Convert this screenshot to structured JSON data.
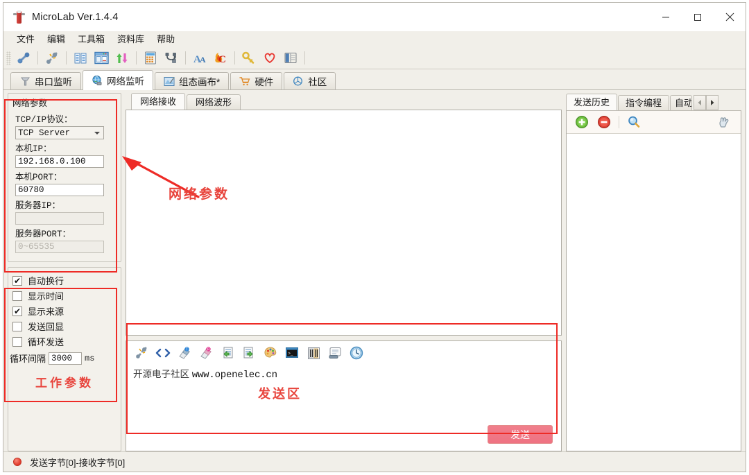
{
  "window": {
    "title": "MicroLab Ver.1.4.4",
    "icon": "app-icon",
    "minimize_label": "─",
    "maximize_label": "□",
    "close_label": "×"
  },
  "menubar": {
    "items": [
      {
        "label": "文件"
      },
      {
        "label": "编辑"
      },
      {
        "label": "工具箱"
      },
      {
        "label": "资料库"
      },
      {
        "label": "帮助"
      }
    ]
  },
  "toolbar": {
    "buttons": [
      {
        "name": "connect-plug-icon"
      },
      {
        "name": "disconnect-plug-icon"
      },
      {
        "name": "columns-view-icon"
      },
      {
        "name": "window-layout-icon"
      },
      {
        "name": "transfer-arrows-icon"
      },
      {
        "name": "calculator-icon"
      },
      {
        "name": "network-nodes-icon"
      },
      {
        "name": "font-icon"
      },
      {
        "name": "c-flame-icon"
      },
      {
        "name": "key-icon"
      },
      {
        "name": "heart-icon"
      },
      {
        "name": "book-icon"
      }
    ]
  },
  "main_tabs": {
    "active_index": 1,
    "items": [
      {
        "label": "串口监听",
        "icon": "serial-port-icon"
      },
      {
        "label": "网络监听",
        "icon": "globe-icon"
      },
      {
        "label": "组态画布*",
        "icon": "canvas-icon"
      },
      {
        "label": "硬件",
        "icon": "cart-icon"
      },
      {
        "label": "社区",
        "icon": "community-icon"
      }
    ]
  },
  "network_params": {
    "group_title": "网络参数",
    "protocol_label": "TCP/IP协议：",
    "protocol_value": "TCP Server",
    "local_ip_label": "本机IP：",
    "local_ip_value": "192.168.0.100",
    "local_port_label": "本机PORT：",
    "local_port_value": "60780",
    "server_ip_label": "服务器IP：",
    "server_ip_value": "",
    "server_port_label": "服务器PORT：",
    "server_port_placeholder": "0~65535"
  },
  "work_params": {
    "annotation": "工作参数",
    "checkboxes": [
      {
        "label": "自动换行",
        "checked": true,
        "mark": "✔"
      },
      {
        "label": "显示时间",
        "checked": false,
        "mark": ""
      },
      {
        "label": "显示来源",
        "checked": true,
        "mark": "✔"
      },
      {
        "label": "发送回显",
        "checked": false,
        "mark": ""
      },
      {
        "label": "循环发送",
        "checked": false,
        "mark": ""
      }
    ],
    "interval_label": "循环间隔",
    "interval_value": "3000",
    "interval_unit": "ms"
  },
  "center": {
    "tabs": {
      "active_index": 0,
      "items": [
        {
          "label": "网络接收"
        },
        {
          "label": "网络波形"
        }
      ]
    },
    "receive_text": "",
    "annotation_net": "网络参数"
  },
  "send_area": {
    "annotation": "发送区",
    "toolbar": [
      {
        "name": "clear-link-icon"
      },
      {
        "name": "hex-code-icon"
      },
      {
        "name": "eraser-t-icon"
      },
      {
        "name": "eraser-r-icon"
      },
      {
        "name": "import-left-icon"
      },
      {
        "name": "export-right-icon"
      },
      {
        "name": "palette-icon"
      },
      {
        "name": "console-icon"
      },
      {
        "name": "barcode-icon"
      },
      {
        "name": "scroll-icon"
      },
      {
        "name": "clock-icon"
      }
    ],
    "text_cn": "开源电子社区",
    "text_url": "www.openelec.cn",
    "send_button": "发送"
  },
  "right_panel": {
    "tabs": {
      "active_index": 0,
      "items": [
        {
          "label": "发送历史"
        },
        {
          "label": "指令编程"
        },
        {
          "label": "自动"
        }
      ]
    },
    "scroll_prev": "◀",
    "scroll_next": "▶",
    "toolbar": [
      {
        "name": "add-icon"
      },
      {
        "name": "remove-icon"
      },
      {
        "name": "search-icon"
      },
      {
        "name": "hand-pointer-icon"
      }
    ]
  },
  "statusbar": {
    "led": "status-led-red",
    "text": "发送字节[0]-接收字节[0]"
  },
  "colors": {
    "accent_red": "#ee2b26",
    "annotation_red": "#e8443c",
    "send_button": "#ef7282",
    "window_bg": "#f1efe9",
    "panel_bg": "#ffffff"
  }
}
